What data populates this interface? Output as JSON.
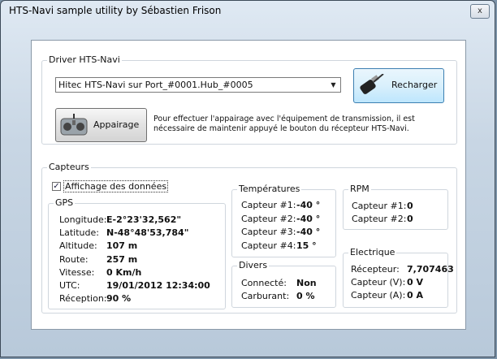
{
  "window": {
    "title": "HTS-Navi sample utility by Sébastien Frison",
    "close_label": "x"
  },
  "driver": {
    "group_label": "Driver HTS-Navi",
    "port_selected": "Hitec HTS-Navi sur Port_#0001.Hub_#0005",
    "reload_label": "Recharger",
    "pair_label": "Appairage",
    "pair_description": "Pour effectuer l'appairage avec l'équipement de transmission, il est nécessaire de maintenir appuyé le bouton du récepteur HTS-Navi."
  },
  "sensors": {
    "group_label": "Capteurs",
    "show_data_label": "Affichage des données",
    "show_data_checked": true,
    "gps": {
      "label": "GPS",
      "rows": [
        {
          "key": "Longitude:",
          "value": "E-2°23'32,562\""
        },
        {
          "key": "Latitude:",
          "value": "N-48°48'53,784\""
        },
        {
          "key": "Altitude:",
          "value": "107 m"
        },
        {
          "key": "Route:",
          "value": "257 m"
        },
        {
          "key": "Vitesse:",
          "value": "0 Km/h"
        },
        {
          "key": "UTC:",
          "value": "19/01/2012 12:34:00"
        },
        {
          "key": "Réception:",
          "value": "90 %"
        }
      ]
    },
    "temperatures": {
      "label": "Températures",
      "rows": [
        {
          "key": "Capteur #1:",
          "value": "-40 °"
        },
        {
          "key": "Capteur #2:",
          "value": "-40 °"
        },
        {
          "key": "Capteur #3:",
          "value": "-40 °"
        },
        {
          "key": "Capteur #4:",
          "value": "15 °"
        }
      ]
    },
    "rpm": {
      "label": "RPM",
      "rows": [
        {
          "key": "Capteur #1:",
          "value": "0"
        },
        {
          "key": "Capteur #2:",
          "value": "0"
        }
      ]
    },
    "divers": {
      "label": "Divers",
      "rows": [
        {
          "key": "Connecté:",
          "value": "Non"
        },
        {
          "key": "Carburant:",
          "value": "0 %"
        }
      ]
    },
    "electrique": {
      "label": "Electrique",
      "rows": [
        {
          "key": "Récepteur:",
          "value": "7,707463"
        },
        {
          "key": "Capteur (V):",
          "value": "0 V"
        },
        {
          "key": "Capteur (A):",
          "value": "0 A"
        }
      ]
    }
  }
}
